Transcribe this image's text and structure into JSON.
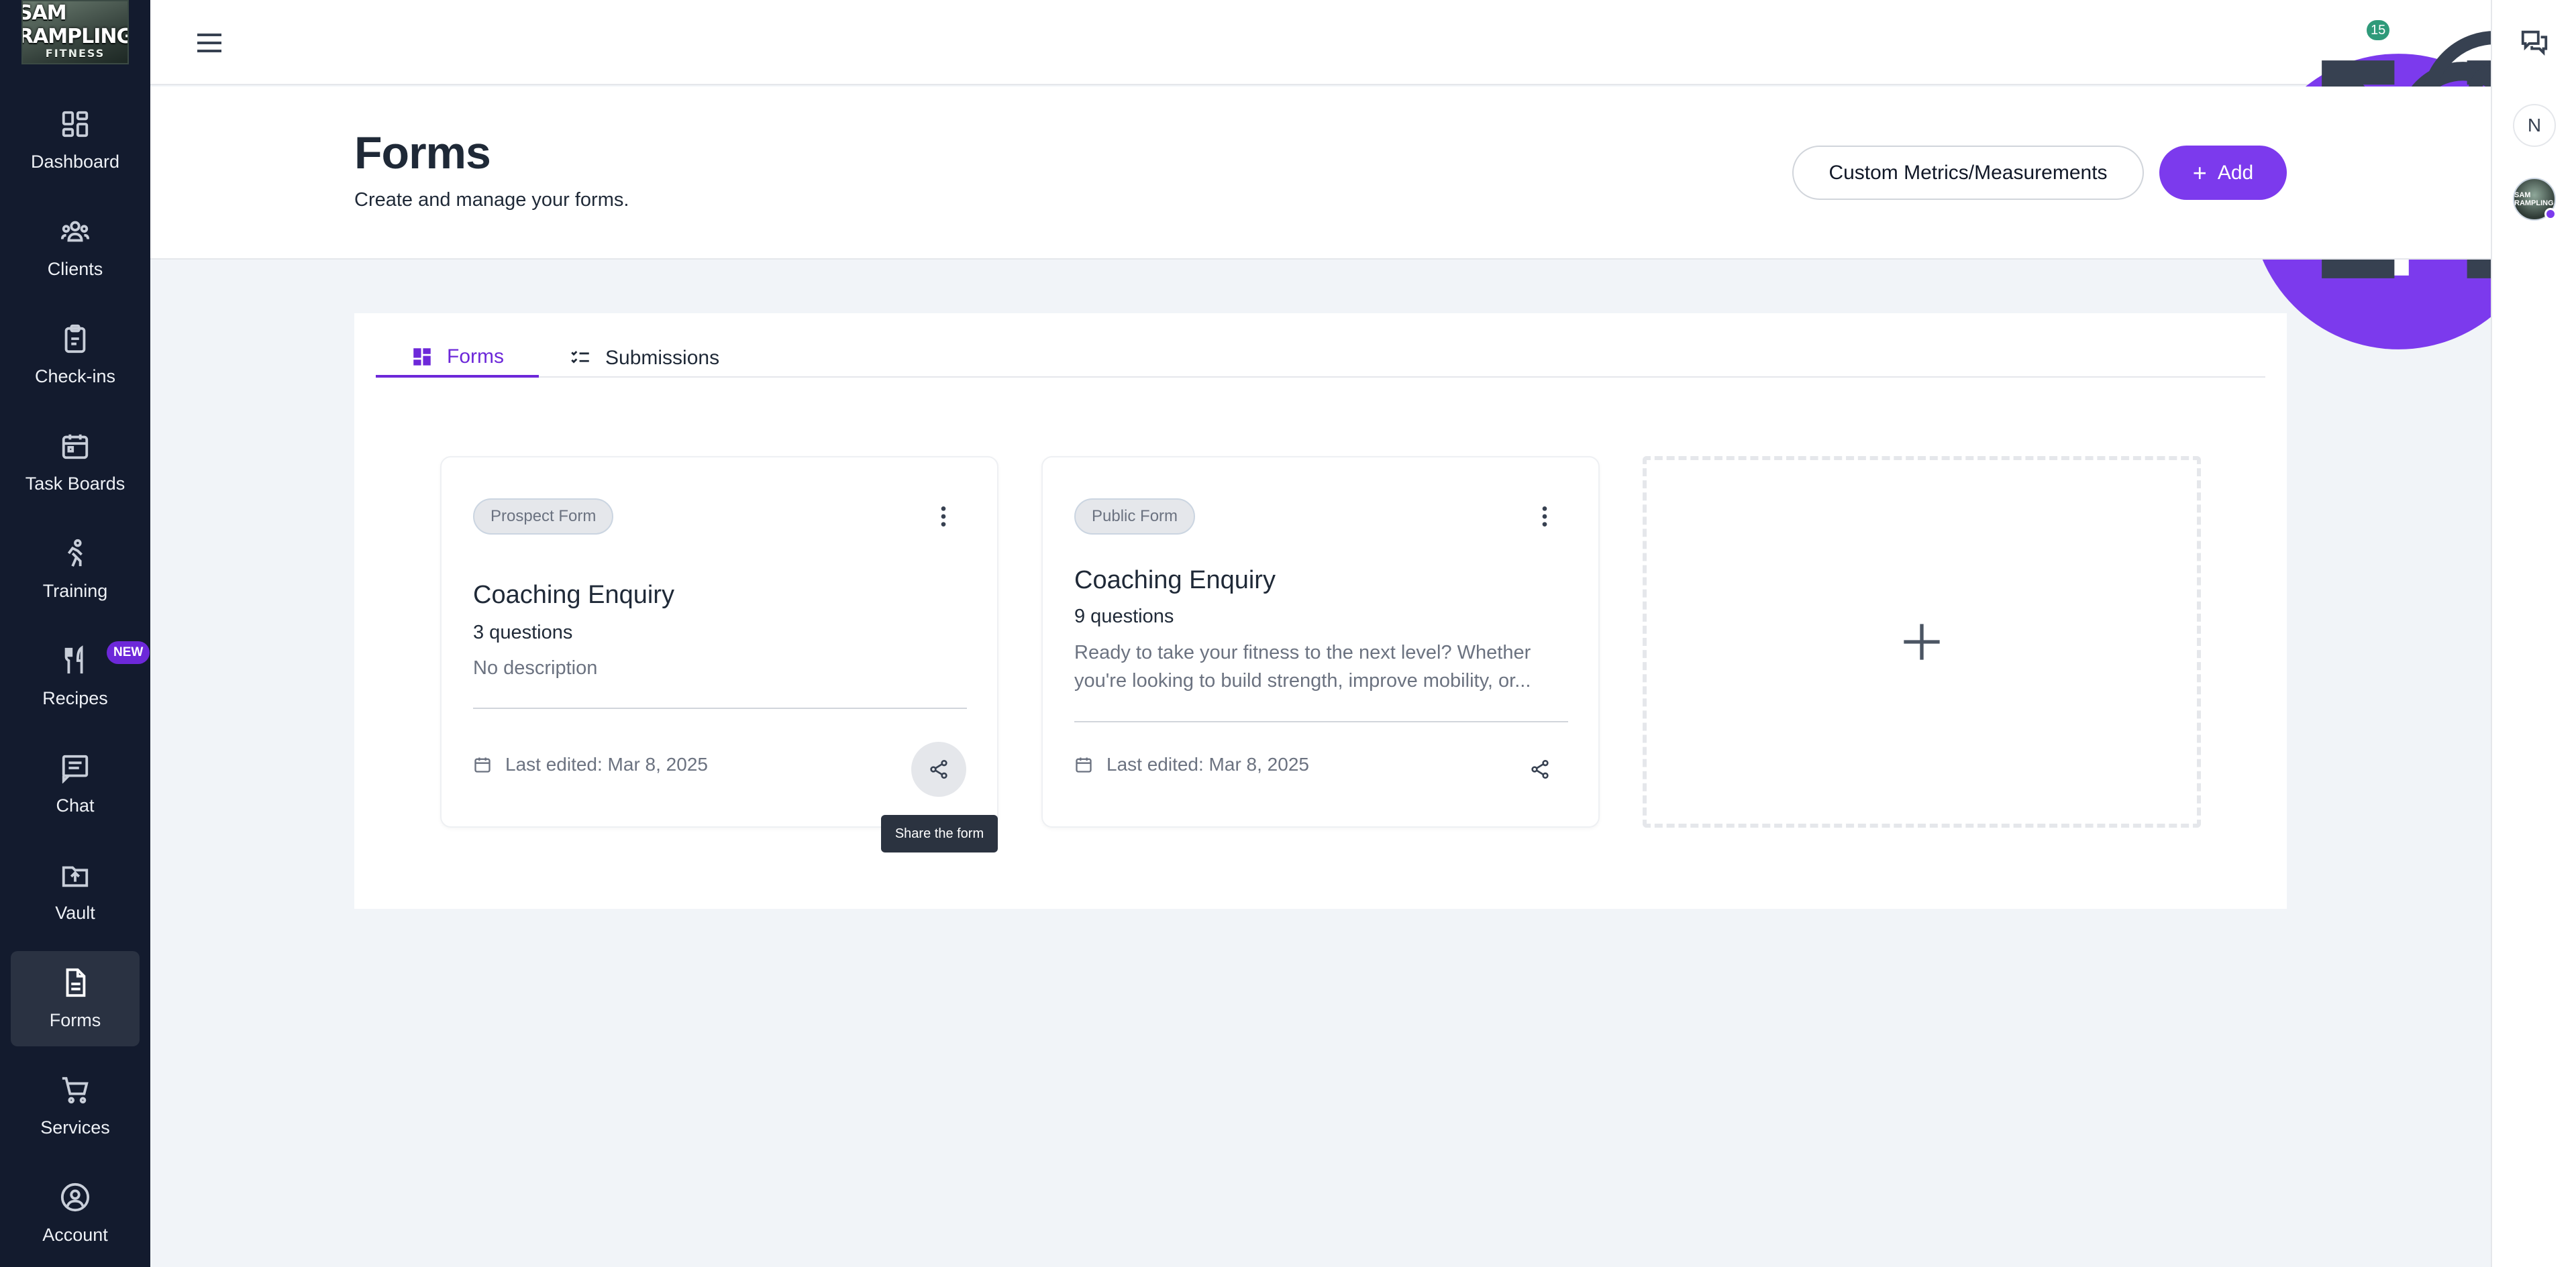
{
  "app": {
    "logo_line1": "SAM RAMPLING",
    "logo_line2": "FITNESS",
    "logo_dots": "● ● ● ●"
  },
  "sidebar": {
    "items": [
      {
        "label": "Dashboard",
        "icon": "dashboard-icon",
        "active": false
      },
      {
        "label": "Clients",
        "icon": "users-icon",
        "active": false
      },
      {
        "label": "Check-ins",
        "icon": "clipboard-icon",
        "active": false
      },
      {
        "label": "Task Boards",
        "icon": "calendar-icon",
        "active": false
      },
      {
        "label": "Training",
        "icon": "running-icon",
        "active": false
      },
      {
        "label": "Recipes",
        "icon": "utensils-icon",
        "active": false,
        "badge": "NEW"
      },
      {
        "label": "Chat",
        "icon": "message-icon",
        "active": false
      },
      {
        "label": "Vault",
        "icon": "folder-upload-icon",
        "active": false
      },
      {
        "label": "Forms",
        "icon": "document-icon",
        "active": true
      },
      {
        "label": "Services",
        "icon": "cart-icon",
        "active": false
      },
      {
        "label": "Account",
        "icon": "account-icon",
        "active": false
      }
    ]
  },
  "topbar": {
    "notification_count": "15"
  },
  "rail": {
    "initial": "N",
    "avatar_text": "SAM RAMPLING"
  },
  "header": {
    "title": "Forms",
    "subtitle": "Create and manage your forms.",
    "custom_metrics_label": "Custom Metrics/Measurements",
    "add_label": "Add"
  },
  "tabs": [
    {
      "label": "Forms",
      "active": true
    },
    {
      "label": "Submissions",
      "active": false
    }
  ],
  "forms": [
    {
      "badge": "Prospect Form",
      "title": "Coaching Enquiry",
      "questions": "3 questions",
      "description": "No description",
      "last_edited": "Last edited: Mar 8, 2025"
    },
    {
      "badge": "Public Form",
      "title": "Coaching Enquiry",
      "questions": "9 questions",
      "description": "Ready to take your fitness to the next level? Whether you're looking to build strength, improve mobility, or...",
      "last_edited": "Last edited: Mar 8, 2025"
    }
  ],
  "tooltip": "Share the form",
  "colors": {
    "sidebar_bg": "#131b2e",
    "accent": "#7c3aed",
    "page_bg": "#f1f4f8"
  }
}
